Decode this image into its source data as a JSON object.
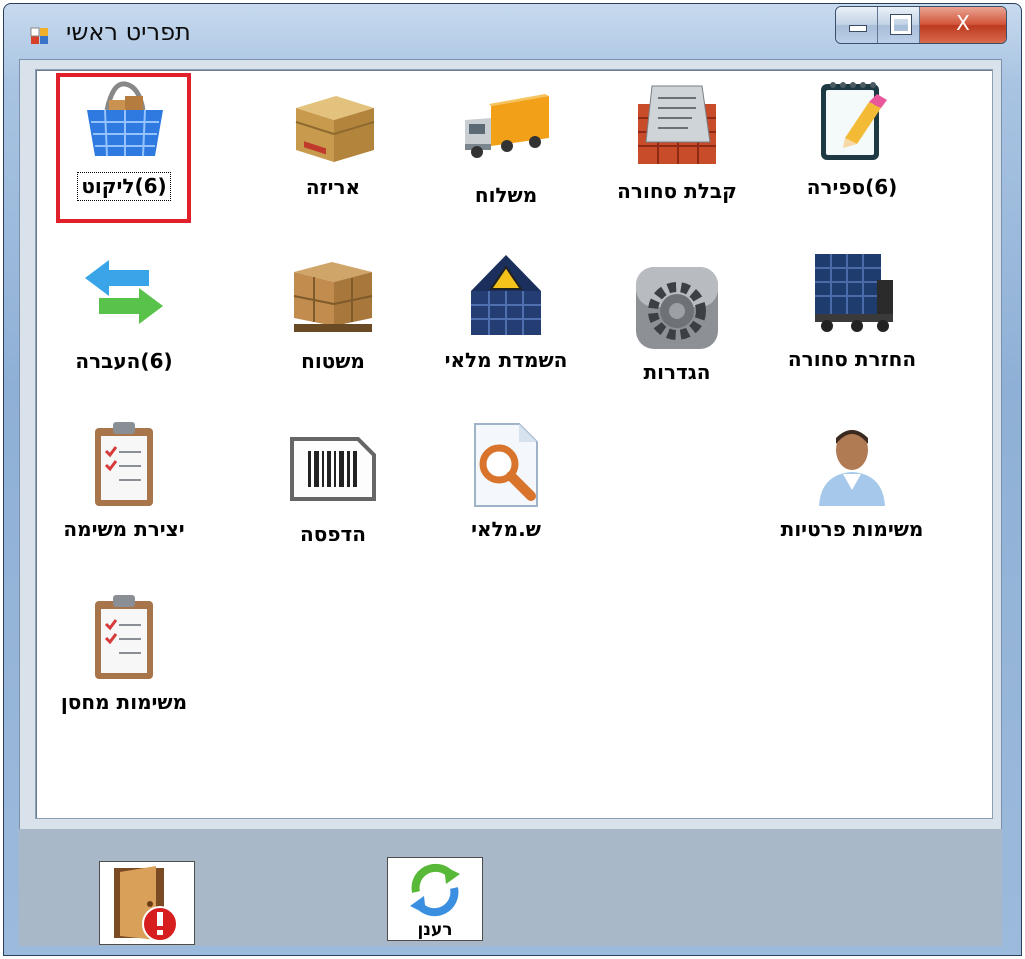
{
  "window": {
    "title": "תפריט ראשי",
    "controls": {
      "minimize": "minimize",
      "maximize": "maximize",
      "close": "X"
    }
  },
  "menu": {
    "row1": [
      {
        "label": "(6)ספירה",
        "icon": "notepad-icon"
      },
      {
        "label": "קבלת סחורה",
        "icon": "pallet-receiving-icon"
      },
      {
        "label": "משלוח",
        "icon": "truck-icon"
      },
      {
        "label": "אריזה",
        "icon": "box-icon"
      },
      {
        "label": "(6)ליקוט",
        "icon": "basket-icon",
        "selected": true
      }
    ],
    "row2": [
      {
        "label": "החזרת סחורה",
        "icon": "container-truck-icon"
      },
      {
        "label": "הגדרות",
        "icon": "gear-icon"
      },
      {
        "label": "השמדת מלאי",
        "icon": "hazard-container-icon"
      },
      {
        "label": "משטוח",
        "icon": "pallet-boxes-icon"
      },
      {
        "label": "(6)העברה",
        "icon": "transfer-arrows-icon"
      }
    ],
    "row3": [
      {
        "label": "משימות פרטיות",
        "icon": "person-icon"
      },
      {
        "label": "ש.מלאי",
        "icon": "search-document-icon"
      },
      {
        "label": "הדפסה",
        "icon": "barcode-icon"
      },
      {
        "label": "יצירת משימה",
        "icon": "clipboard-icon"
      }
    ],
    "row4": [
      {
        "label": "משימות מחסן",
        "icon": "clipboard-icon"
      }
    ]
  },
  "footer": {
    "exit_icon": "exit-door-icon",
    "refresh_label": "רענן",
    "refresh_icon": "refresh-icon"
  },
  "colors": {
    "selection": "#e0212c",
    "window_frame": "#8fb0d6",
    "footer": "#a9b8c8"
  }
}
